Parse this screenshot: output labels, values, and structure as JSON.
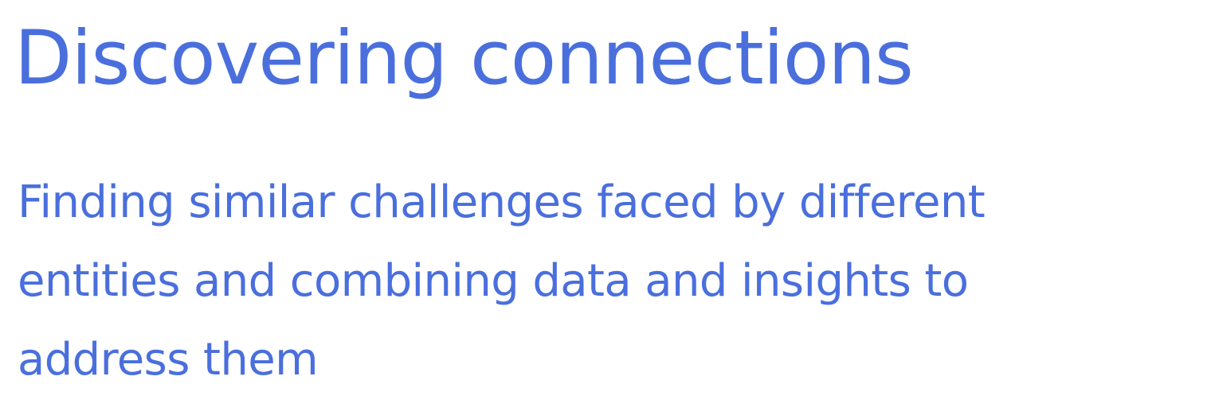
{
  "slide": {
    "title": "Discovering connections",
    "subtitle_lines": [
      "Finding similar challenges faced by different",
      "entities and combining data and insights to",
      "address them"
    ]
  },
  "colors": {
    "text": "#4a6fdd",
    "background": "#ffffff"
  }
}
